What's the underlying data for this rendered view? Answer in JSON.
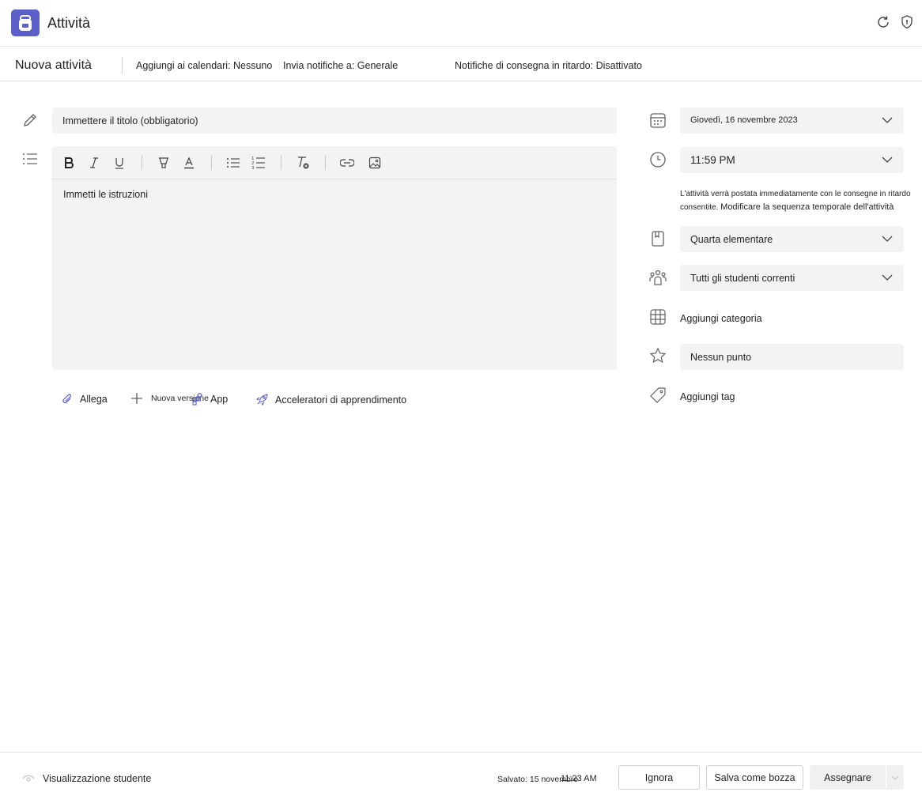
{
  "app": {
    "title": "Attività",
    "icons": [
      "backpack-icon",
      "refresh-icon",
      "shield-icon"
    ]
  },
  "command_bar": {
    "page_title": "Nuova attività",
    "calendars": "Aggiungi ai calendari: Nessuno",
    "notifications": "Invia notifiche a: Generale",
    "late_notifications": "Notifiche di consegna in ritardo: Disattivato"
  },
  "form": {
    "title_placeholder": "Immettere il titolo (obbligatorio)",
    "instructions_placeholder": "Immetti le istruzioni",
    "toolbar_icons": [
      "bold-icon",
      "italic-icon",
      "underline-icon",
      "highlight-icon",
      "font-color-icon",
      "bullet-list-icon",
      "numbered-list-icon",
      "clear-format-icon",
      "link-icon",
      "image-icon"
    ],
    "attach_label": "Allega",
    "new_version_label": "Nuova versione",
    "app_label": "App",
    "accelerators_label": "Acceleratori di apprendimento"
  },
  "details": {
    "due_date": "Giovedì, 16 novembre 2023",
    "due_time": "11:59 PM",
    "late_note": "L'attività verrà postata immediatamente con le consegne in ritardo consentite.",
    "timeline_link": "Modificare la sequenza temporale dell'attività",
    "class": "Quarta elementare",
    "students": "Tutti gli studenti correnti",
    "category_link": "Aggiungi categoria",
    "points": "Nessun punto",
    "tag_link": "Aggiungi tag"
  },
  "footer": {
    "student_view": "Visualizzazione studente",
    "saved_label": "Salvato: 15 novembre",
    "saved_time": "11:23 AM",
    "discard": "Ignora",
    "save_draft": "Salva come bozza",
    "assign": "Assegnare"
  },
  "colors": {
    "brand": "#5b5fc7",
    "field_bg": "#f3f3f3"
  }
}
